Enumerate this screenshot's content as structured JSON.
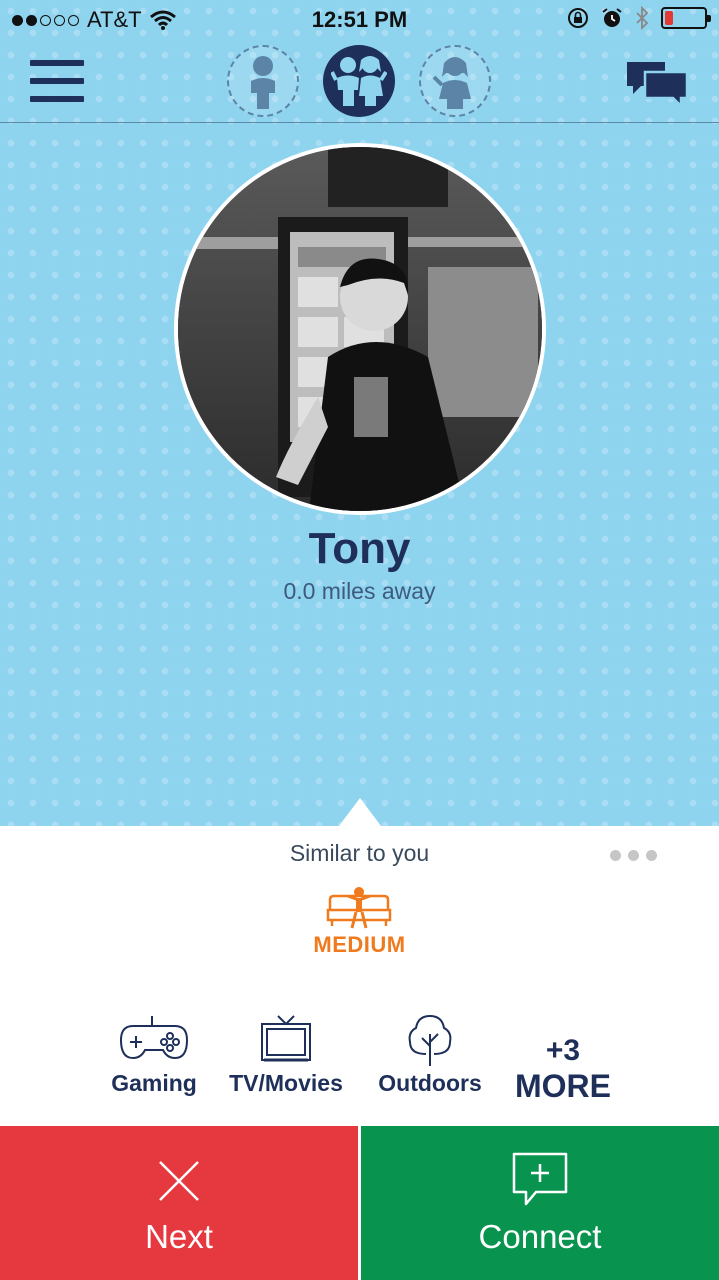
{
  "status_bar": {
    "carrier": "AT&T",
    "time": "12:51 PM",
    "signal_bars_filled": 2,
    "signal_bars_total": 5,
    "battery_level": 0.2
  },
  "nav": {
    "tabs": [
      "male-profile-icon",
      "couple-profile-icon",
      "female-profile-icon"
    ],
    "active_tab": "couple-profile-icon"
  },
  "profile": {
    "name": "Tony",
    "distance": "0.0 miles away"
  },
  "similarity": {
    "label": "Similar to you",
    "energy_level": "MEDIUM"
  },
  "interests": [
    {
      "label": "Gaming",
      "icon": "gamepad-icon"
    },
    {
      "label": "TV/Movies",
      "icon": "tv-icon"
    },
    {
      "label": "Outdoors",
      "icon": "tree-icon"
    }
  ],
  "more_interests": {
    "count": "+3",
    "label": "MORE"
  },
  "actions": {
    "next_label": "Next",
    "connect_label": "Connect"
  },
  "colors": {
    "background_blue": "#8fd4ef",
    "navy": "#1e2f5a",
    "orange": "#f07a1e",
    "next_red": "#e5393f",
    "connect_green": "#08944f"
  }
}
